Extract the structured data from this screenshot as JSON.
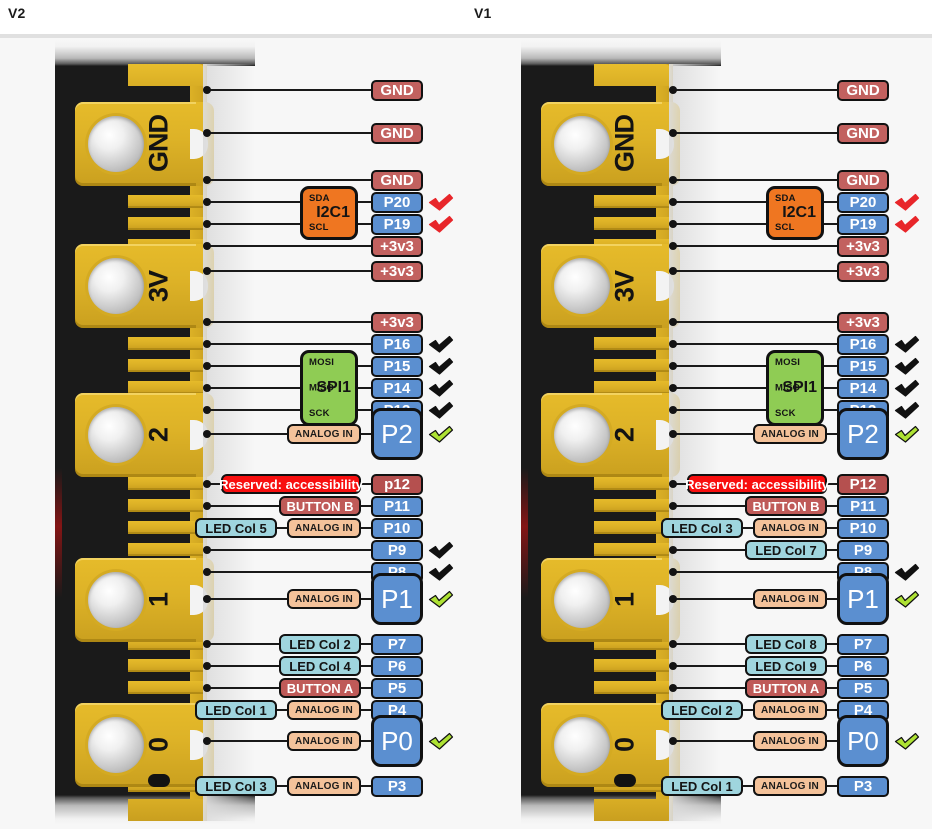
{
  "page": {
    "titles": [
      {
        "id": "v2",
        "label": "V2"
      },
      {
        "id": "v1",
        "label": "V1"
      }
    ]
  },
  "colors": {
    "power": "#c2615f",
    "gpio": "#5b8fd0",
    "analog_tag": "#f4c29a",
    "led_tag": "#9fd5de",
    "button_tag": "#bf5a58",
    "reserved_tag": "#f80f0f",
    "i2c_bus": "#ef7621",
    "spi_bus": "#8fcc54",
    "gold": "#ddb227",
    "board": "#1a1a1a",
    "check_black": "#111111",
    "check_green": "#aee234",
    "check_red": "#e8262a",
    "panel_bg": "#f7f7f7"
  },
  "board": {
    "big_pad_labels": [
      "GND",
      "3V",
      "2",
      "1",
      "0"
    ],
    "bus_blocks": [
      {
        "name": "I2C1",
        "signals": [
          "SDA",
          "SCL"
        ]
      },
      {
        "name": "SPI1",
        "signals": [
          "MOSI",
          "MISO",
          "SCK"
        ]
      }
    ]
  },
  "diagrams": [
    {
      "id": "v2",
      "title": "V2",
      "pins": [
        {
          "label": "GND",
          "type": "power",
          "size": "small",
          "check": null
        },
        {
          "label": "GND",
          "type": "power",
          "size": "small",
          "check": null
        },
        {
          "label": "GND",
          "type": "power",
          "size": "small",
          "check": null
        },
        {
          "label": "P20",
          "type": "gpio",
          "size": "small",
          "check": "red",
          "bus": "I2C1",
          "bus_signal": "SDA"
        },
        {
          "label": "P19",
          "type": "gpio",
          "size": "small",
          "check": "red",
          "bus": "I2C1",
          "bus_signal": "SCL"
        },
        {
          "label": "+3v3",
          "type": "power",
          "size": "small",
          "check": null
        },
        {
          "label": "+3v3",
          "type": "power",
          "size": "small",
          "check": null
        },
        {
          "label": "+3v3",
          "type": "power",
          "size": "small",
          "check": null
        },
        {
          "label": "P16",
          "type": "gpio",
          "size": "small",
          "check": "black"
        },
        {
          "label": "P15",
          "type": "gpio",
          "size": "small",
          "check": "black",
          "bus": "SPI1",
          "bus_signal": "MOSI"
        },
        {
          "label": "P14",
          "type": "gpio",
          "size": "small",
          "check": "black",
          "bus": "SPI1",
          "bus_signal": "MISO"
        },
        {
          "label": "P13",
          "type": "gpio",
          "size": "small",
          "check": "black",
          "bus": "SPI1",
          "bus_signal": "SCK"
        },
        {
          "label": "P2",
          "type": "gpio",
          "size": "big",
          "check": "green",
          "tags": [
            "ANALOG IN"
          ]
        },
        {
          "label": "p12",
          "type": "dark",
          "size": "small",
          "check": null,
          "tags": [
            "Reserved: accessibility"
          ]
        },
        {
          "label": "P11",
          "type": "gpio",
          "size": "small",
          "check": null,
          "tags": [
            "BUTTON B"
          ]
        },
        {
          "label": "P10",
          "type": "gpio",
          "size": "small",
          "check": null,
          "tags": [
            "LED Col 5",
            "ANALOG IN"
          ]
        },
        {
          "label": "P9",
          "type": "gpio",
          "size": "small",
          "check": "black"
        },
        {
          "label": "P8",
          "type": "gpio",
          "size": "small",
          "check": "black"
        },
        {
          "label": "P1",
          "type": "gpio",
          "size": "big",
          "check": "green",
          "tags": [
            "ANALOG IN"
          ]
        },
        {
          "label": "P7",
          "type": "gpio",
          "size": "small",
          "check": null,
          "tags": [
            "LED Col 2"
          ]
        },
        {
          "label": "P6",
          "type": "gpio",
          "size": "small",
          "check": null,
          "tags": [
            "LED Col 4"
          ]
        },
        {
          "label": "P5",
          "type": "gpio",
          "size": "small",
          "check": null,
          "tags": [
            "BUTTON A"
          ]
        },
        {
          "label": "P4",
          "type": "gpio",
          "size": "small",
          "check": null,
          "tags": [
            "LED Col 1",
            "ANALOG IN"
          ]
        },
        {
          "label": "P0",
          "type": "gpio",
          "size": "big",
          "check": "green",
          "tags": [
            "ANALOG IN"
          ]
        },
        {
          "label": "P3",
          "type": "gpio",
          "size": "small",
          "check": null,
          "tags": [
            "LED Col 3",
            "ANALOG IN"
          ]
        }
      ]
    },
    {
      "id": "v1",
      "title": "V1",
      "pins": [
        {
          "label": "GND",
          "type": "power",
          "size": "small",
          "check": null
        },
        {
          "label": "GND",
          "type": "power",
          "size": "small",
          "check": null
        },
        {
          "label": "GND",
          "type": "power",
          "size": "small",
          "check": null
        },
        {
          "label": "P20",
          "type": "gpio",
          "size": "small",
          "check": "red",
          "bus": "I2C1",
          "bus_signal": "SDA"
        },
        {
          "label": "P19",
          "type": "gpio",
          "size": "small",
          "check": "red",
          "bus": "I2C1",
          "bus_signal": "SCL"
        },
        {
          "label": "+3v3",
          "type": "power",
          "size": "small",
          "check": null
        },
        {
          "label": "+3v3",
          "type": "power",
          "size": "small",
          "check": null
        },
        {
          "label": "+3v3",
          "type": "power",
          "size": "small",
          "check": null
        },
        {
          "label": "P16",
          "type": "gpio",
          "size": "small",
          "check": "black"
        },
        {
          "label": "P15",
          "type": "gpio",
          "size": "small",
          "check": "black",
          "bus": "SPI1",
          "bus_signal": "MOSI"
        },
        {
          "label": "P14",
          "type": "gpio",
          "size": "small",
          "check": "black",
          "bus": "SPI1",
          "bus_signal": "MISO"
        },
        {
          "label": "P13",
          "type": "gpio",
          "size": "small",
          "check": "black",
          "bus": "SPI1",
          "bus_signal": "SCK"
        },
        {
          "label": "P2",
          "type": "gpio",
          "size": "big",
          "check": "green",
          "tags": [
            "ANALOG IN"
          ]
        },
        {
          "label": "P12",
          "type": "dark",
          "size": "small",
          "check": null,
          "tags": [
            "Reserved: accessibility"
          ]
        },
        {
          "label": "P11",
          "type": "gpio",
          "size": "small",
          "check": null,
          "tags": [
            "BUTTON B"
          ]
        },
        {
          "label": "P10",
          "type": "gpio",
          "size": "small",
          "check": null,
          "tags": [
            "LED Col 3",
            "ANALOG IN"
          ]
        },
        {
          "label": "P9",
          "type": "gpio",
          "size": "small",
          "check": null,
          "tags": [
            "LED Col 7"
          ]
        },
        {
          "label": "P8",
          "type": "gpio",
          "size": "small",
          "check": "black"
        },
        {
          "label": "P1",
          "type": "gpio",
          "size": "big",
          "check": "green",
          "tags": [
            "ANALOG IN"
          ]
        },
        {
          "label": "P7",
          "type": "gpio",
          "size": "small",
          "check": null,
          "tags": [
            "LED Col 8"
          ]
        },
        {
          "label": "P6",
          "type": "gpio",
          "size": "small",
          "check": null,
          "tags": [
            "LED Col 9"
          ]
        },
        {
          "label": "P5",
          "type": "gpio",
          "size": "small",
          "check": null,
          "tags": [
            "BUTTON A"
          ]
        },
        {
          "label": "P4",
          "type": "gpio",
          "size": "small",
          "check": null,
          "tags": [
            "LED Col 2",
            "ANALOG IN"
          ]
        },
        {
          "label": "P0",
          "type": "gpio",
          "size": "big",
          "check": "green",
          "tags": [
            "ANALOG IN"
          ]
        },
        {
          "label": "P3",
          "type": "gpio",
          "size": "small",
          "check": null,
          "tags": [
            "LED Col 1",
            "ANALOG IN"
          ]
        }
      ]
    }
  ]
}
